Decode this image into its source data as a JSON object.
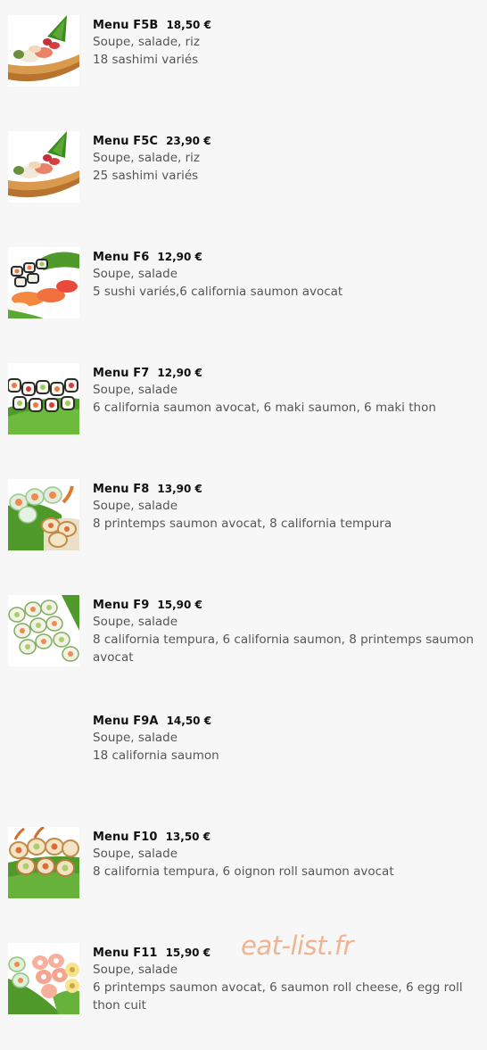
{
  "menu_items": [
    {
      "name": "Menu F5B",
      "price": "18,50 €",
      "line1": "Soupe, salade, riz",
      "line2": "18 sashimi variés",
      "image": "sashimi-boat"
    },
    {
      "name": "Menu F5C",
      "price": "23,90 €",
      "line1": "Soupe, salade, riz",
      "line2": "25 sashimi variés",
      "image": "sashimi-boat"
    },
    {
      "name": "Menu F6",
      "price": "12,90 €",
      "line1": "Soupe, salade",
      "line2": "5 sushi variés,6 california saumon avocat",
      "image": "sushi-california-plate"
    },
    {
      "name": "Menu F7",
      "price": "12,90 €",
      "line1": "Soupe, salade",
      "line2": "6 california saumon avocat, 6 maki saumon, 6 maki thon",
      "image": "maki-plate"
    },
    {
      "name": "Menu F8",
      "price": "13,90 €",
      "line1": "Soupe, salade",
      "line2": "8 printemps saumon avocat, 8 california tempura",
      "image": "printemps-tempura-plate"
    },
    {
      "name": "Menu F9",
      "price": "15,90 €",
      "line1": "Soupe, salade",
      "line2": "8 california tempura, 6 california saumon, 8 printemps saumon avocat",
      "image": "california-rolls-plate"
    },
    {
      "name": "Menu F9A",
      "price": "14,50 €",
      "line1": "Soupe, salade",
      "line2": "18 california saumon",
      "image": ""
    },
    {
      "name": "Menu F10",
      "price": "13,50 €",
      "line1": "Soupe, salade",
      "line2": "8 california tempura, 6 oignon roll saumon avocat",
      "image": "tempura-onion-roll-plate"
    },
    {
      "name": "Menu F11",
      "price": "15,90 €",
      "line1": "Soupe, salade",
      "line2": "6 printemps saumon avocat, 6 saumon roll cheese, 6 egg roll thon cuit",
      "image": "printemps-cheese-egg-plate"
    }
  ],
  "watermark": "eat-list.fr",
  "colors": {
    "background": "#f7f7f7",
    "title_text": "#111111",
    "description_text": "#555555",
    "watermark": "#f0b18d"
  }
}
